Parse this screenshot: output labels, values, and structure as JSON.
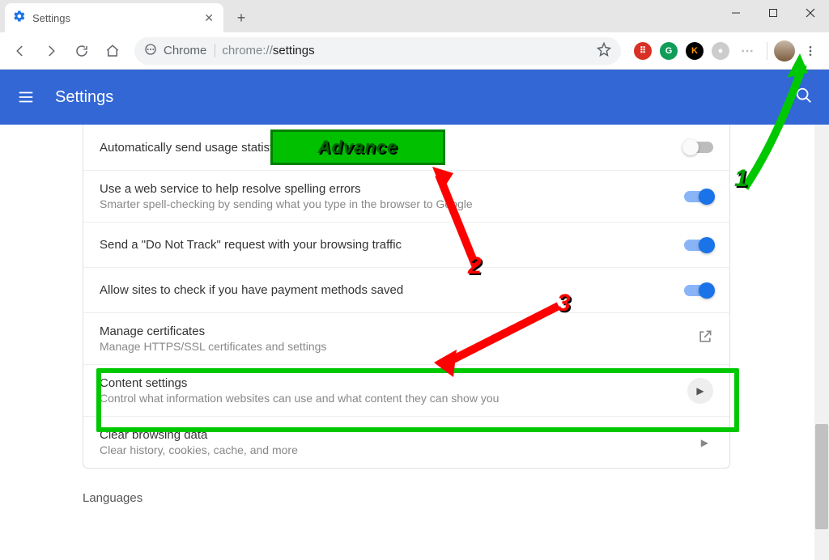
{
  "window": {
    "tab_title": "Settings"
  },
  "toolbar": {
    "chip": "Chrome",
    "url_prefix": "chrome://",
    "url_path": "settings"
  },
  "header": {
    "title": "Settings"
  },
  "rows": {
    "usage": {
      "title": "Automatically send usage statistics and crash reports to Google",
      "toggle": "off"
    },
    "spell": {
      "title": "Use a web service to help resolve spelling errors",
      "sub": "Smarter spell-checking by sending what you type in the browser to Google",
      "toggle": "on"
    },
    "dnt": {
      "title": "Send a \"Do Not Track\" request with your browsing traffic",
      "toggle": "on"
    },
    "payment": {
      "title": "Allow sites to check if you have payment methods saved",
      "toggle": "on"
    },
    "certs": {
      "title": "Manage certificates",
      "sub": "Manage HTTPS/SSL certificates and settings"
    },
    "content": {
      "title": "Content settings",
      "sub": "Control what information websites can use and what content they can show you"
    },
    "clearData": {
      "title": "Clear browsing data",
      "sub": "Clear history, cookies, cache, and more"
    }
  },
  "sections": {
    "languages": "Languages"
  },
  "annotations": {
    "advance": "Advance",
    "step1": "1",
    "step2": "2",
    "step3": "3"
  }
}
